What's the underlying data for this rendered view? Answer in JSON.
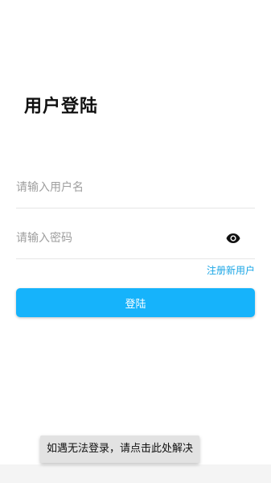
{
  "page": {
    "title": "用户登陆"
  },
  "form": {
    "username_placeholder": "请输入用户名",
    "username_value": "",
    "password_placeholder": "请输入密码",
    "password_value": "",
    "password_toggle_icon": "eye-icon",
    "register_label": "注册新用户",
    "login_label": "登陆"
  },
  "toast": {
    "text": "如遇无法登录，请点击此处解决"
  },
  "colors": {
    "accent": "#16b3fb",
    "link": "#1aa6e6",
    "title": "#111111",
    "placeholder": "#9e9e9e"
  }
}
